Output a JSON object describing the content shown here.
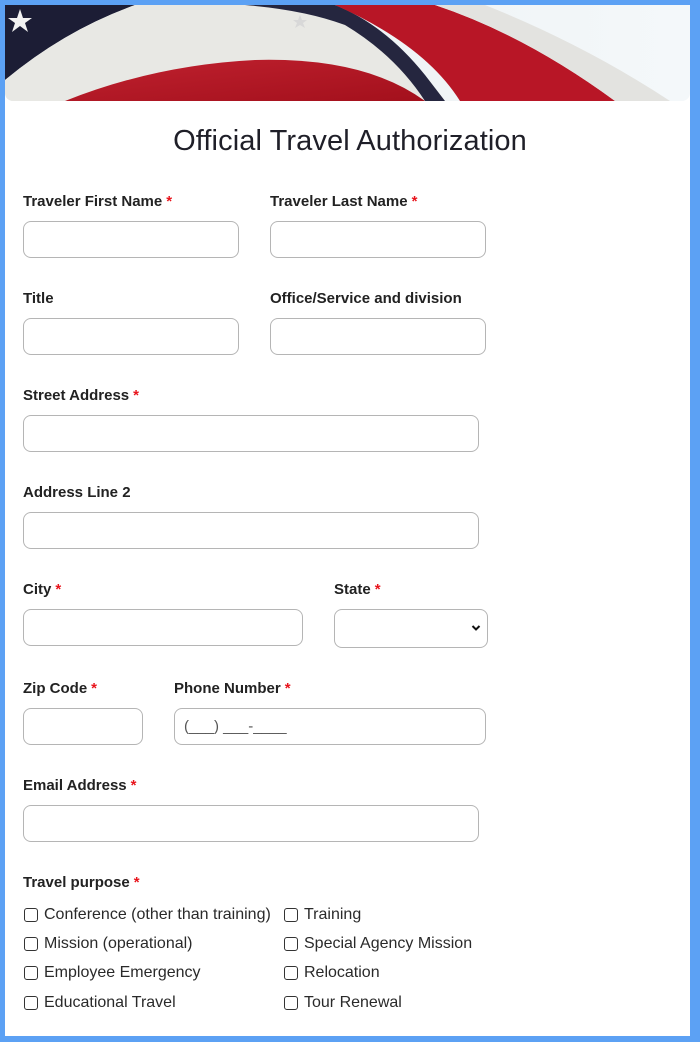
{
  "form": {
    "title": "Official Travel Authorization",
    "required_marker": "*",
    "colors": {
      "frame": "#5ca1f4",
      "required": "#e8141c",
      "input_border": "#b5b5b5"
    },
    "fields": {
      "first_name": {
        "label": "Traveler First Name",
        "required": true,
        "value": ""
      },
      "last_name": {
        "label": "Traveler Last Name",
        "required": true,
        "value": ""
      },
      "title": {
        "label": "Title",
        "required": false,
        "value": ""
      },
      "office": {
        "label": "Office/Service and division",
        "required": false,
        "value": ""
      },
      "street": {
        "label": "Street Address",
        "required": true,
        "value": ""
      },
      "address2": {
        "label": "Address Line 2",
        "required": false,
        "value": ""
      },
      "city": {
        "label": "City",
        "required": true,
        "value": ""
      },
      "state": {
        "label": "State",
        "required": true,
        "selected": ""
      },
      "zip": {
        "label": "Zip Code",
        "required": true,
        "value": ""
      },
      "phone": {
        "label": "Phone Number",
        "required": true,
        "value": "",
        "placeholder": "(___) ___-____"
      },
      "email": {
        "label": "Email Address",
        "required": true,
        "value": ""
      }
    },
    "travel_purpose": {
      "label": "Travel purpose",
      "required": true,
      "options": [
        {
          "label": "Conference (other than training)",
          "checked": false
        },
        {
          "label": "Training",
          "checked": false
        },
        {
          "label": "Mission (operational)",
          "checked": false
        },
        {
          "label": "Special Agency Mission",
          "checked": false
        },
        {
          "label": "Employee Emergency",
          "checked": false
        },
        {
          "label": "Relocation",
          "checked": false
        },
        {
          "label": "Educational Travel",
          "checked": false
        },
        {
          "label": "Tour Renewal",
          "checked": false
        }
      ]
    },
    "banner": {
      "icon": "american-flag-banner"
    }
  }
}
